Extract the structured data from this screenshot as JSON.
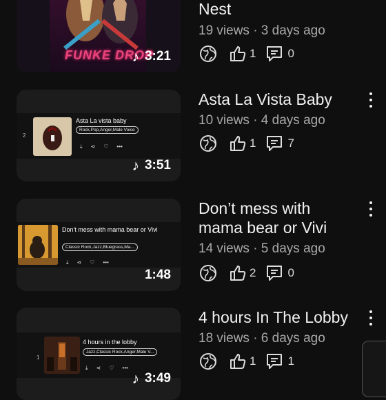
{
  "videos": [
    {
      "title": "Nest",
      "meta": "19 views · 3 days ago",
      "likes": "1",
      "comments": "0",
      "duration": "3:21",
      "thumb_logo_text": "FUNKE DROP"
    },
    {
      "title": "Asta La Vista Baby",
      "meta": "10 views · 4 days ago",
      "likes": "1",
      "comments": "7",
      "duration": "3:51",
      "card": {
        "number": "2",
        "title": "Asta La vista baby",
        "tags": "Rock,Pop,Anger,Male Voice"
      }
    },
    {
      "title": "Don’t mess with mama bear or Vivi",
      "meta": "14 views · 5 days ago",
      "likes": "2",
      "comments": "0",
      "duration": "1:48",
      "card": {
        "number": "",
        "title": "Don't mess with mama bear or Vivi",
        "tags": "Classic Rock,Jazz,Bluegrass,Ma..."
      }
    },
    {
      "title": "4 hours In The Lobby",
      "meta": "18 views · 6 days ago",
      "likes": "1",
      "comments": "1",
      "duration": "3:49",
      "card": {
        "number": "1",
        "title": "4 hours in the lobby",
        "tags": "Jazz,Classic Rock,Anger,Male V..."
      }
    }
  ],
  "icons": {
    "visibility": "globe-icon",
    "like": "thumbs-up-icon",
    "comment": "comment-icon",
    "music": "music-note-icon",
    "menu": "more-vert-icon"
  }
}
